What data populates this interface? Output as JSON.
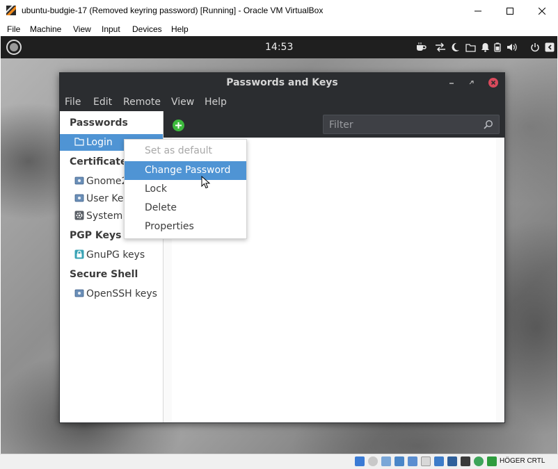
{
  "host": {
    "title": "ubuntu-budgie-17 (Removed keyring password) [Running] - Oracle VM VirtualBox",
    "menu": [
      "File",
      "Machine",
      "View",
      "Input",
      "Devices",
      "Help"
    ],
    "statusbar_text": "HÖGER CRTL"
  },
  "panel": {
    "clock": "14:53"
  },
  "app": {
    "title": "Passwords and Keys",
    "menu": [
      "File",
      "Edit",
      "Remote",
      "View",
      "Help"
    ],
    "filter_placeholder": "Filter",
    "sidebar": {
      "sections": [
        {
          "title": "Passwords",
          "items": [
            {
              "label": "Login",
              "icon": "folder-icon",
              "selected": true
            }
          ]
        },
        {
          "title": "Certificates",
          "items": [
            {
              "label": "Gnome2",
              "icon": "keyring-icon"
            },
            {
              "label": "User Key",
              "icon": "keyring-icon"
            },
            {
              "label": "System T",
              "icon": "gear-icon"
            }
          ]
        },
        {
          "title": "PGP Keys",
          "items": [
            {
              "label": "GnuPG keys",
              "icon": "lock-icon"
            }
          ]
        },
        {
          "title": "Secure Shell",
          "items": [
            {
              "label": "OpenSSH keys",
              "icon": "keyring-icon"
            }
          ]
        }
      ]
    }
  },
  "context_menu": {
    "items": [
      {
        "label": "Set as default",
        "state": "disabled"
      },
      {
        "label": "Change Password",
        "state": "hover"
      },
      {
        "label": "Lock",
        "state": "normal"
      },
      {
        "label": "Delete",
        "state": "normal"
      },
      {
        "label": "Properties",
        "state": "normal"
      }
    ]
  },
  "colors": {
    "selection": "#4f94d4",
    "app_bg": "#2b2d30",
    "close_button": "#d94a5c",
    "add_button": "#3dba3d"
  }
}
